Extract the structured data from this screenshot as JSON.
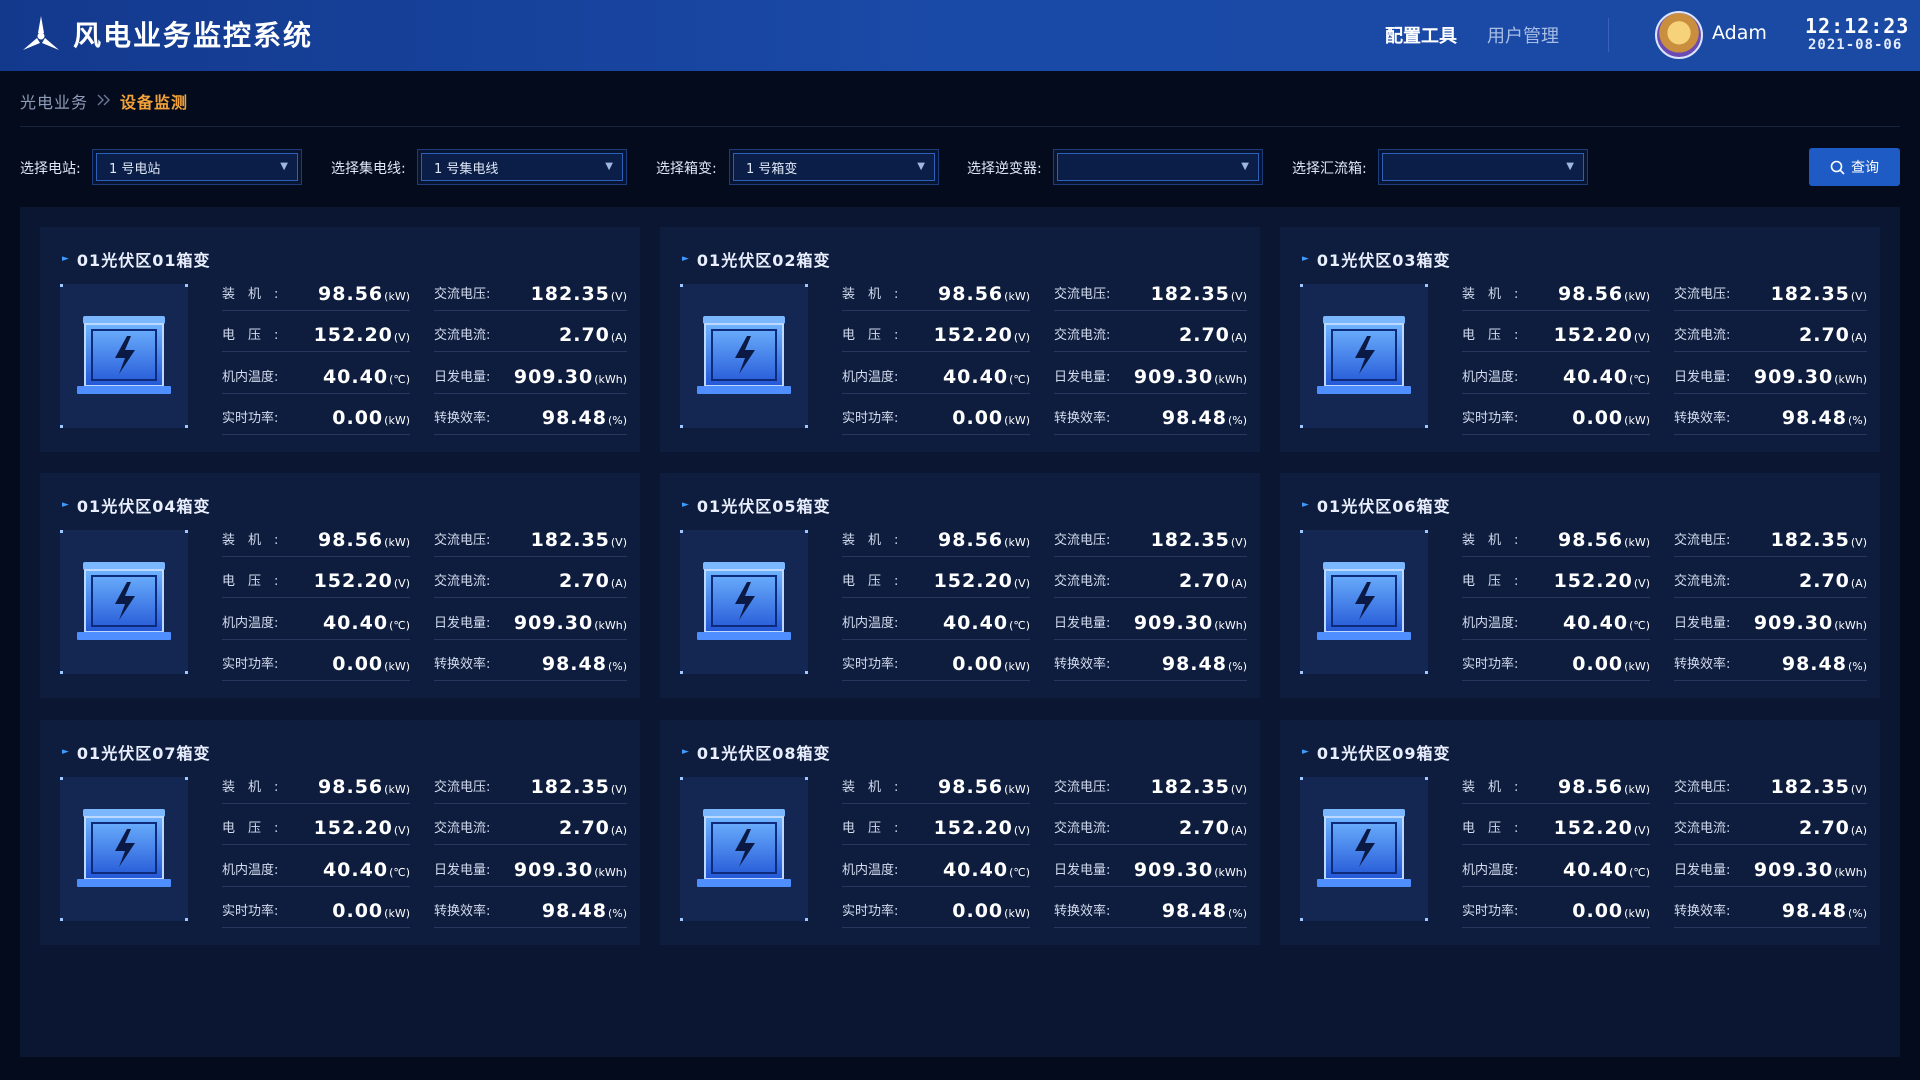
{
  "header": {
    "title": "风电业务监控系统",
    "nav": [
      "配置工具",
      "用户管理"
    ],
    "username": "Adam",
    "time": "12:12:23",
    "date": "2021-08-06"
  },
  "breadcrumb": {
    "parent": "光电业务",
    "current": "设备监测"
  },
  "filters": [
    {
      "label": "选择电站:",
      "value": "1 号电站"
    },
    {
      "label": "选择集电线:",
      "value": "1 号集电线"
    },
    {
      "label": "选择箱变:",
      "value": "1 号箱变"
    },
    {
      "label": "选择逆变器:",
      "value": ""
    },
    {
      "label": "选择汇流箱:",
      "value": ""
    }
  ],
  "query_label": "查询",
  "cards": [
    {
      "title": "01光伏区01箱变",
      "metrics": [
        {
          "label": "装　机　:",
          "value": "98.56",
          "unit": "(kW)"
        },
        {
          "label": "交流电压:",
          "value": "182.35",
          "unit": "(V)"
        },
        {
          "label": "电　压　:",
          "value": "152.20",
          "unit": "(V)"
        },
        {
          "label": "交流电流:",
          "value": "2.70",
          "unit": "(A)"
        },
        {
          "label": "机内温度:",
          "value": "40.40",
          "unit": "(℃)"
        },
        {
          "label": "日发电量:",
          "value": "909.30",
          "unit": "(kWh)"
        },
        {
          "label": "实时功率:",
          "value": "0.00",
          "unit": "(kW)"
        },
        {
          "label": "转换效率:",
          "value": "98.48",
          "unit": "(%)"
        }
      ]
    },
    {
      "title": "01光伏区02箱变",
      "metrics": [
        {
          "label": "装　机　:",
          "value": "98.56",
          "unit": "(kW)"
        },
        {
          "label": "交流电压:",
          "value": "182.35",
          "unit": "(V)"
        },
        {
          "label": "电　压　:",
          "value": "152.20",
          "unit": "(V)"
        },
        {
          "label": "交流电流:",
          "value": "2.70",
          "unit": "(A)"
        },
        {
          "label": "机内温度:",
          "value": "40.40",
          "unit": "(℃)"
        },
        {
          "label": "日发电量:",
          "value": "909.30",
          "unit": "(kWh)"
        },
        {
          "label": "实时功率:",
          "value": "0.00",
          "unit": "(kW)"
        },
        {
          "label": "转换效率:",
          "value": "98.48",
          "unit": "(%)"
        }
      ]
    },
    {
      "title": "01光伏区03箱变",
      "metrics": [
        {
          "label": "装　机　:",
          "value": "98.56",
          "unit": "(kW)"
        },
        {
          "label": "交流电压:",
          "value": "182.35",
          "unit": "(V)"
        },
        {
          "label": "电　压　:",
          "value": "152.20",
          "unit": "(V)"
        },
        {
          "label": "交流电流:",
          "value": "2.70",
          "unit": "(A)"
        },
        {
          "label": "机内温度:",
          "value": "40.40",
          "unit": "(℃)"
        },
        {
          "label": "日发电量:",
          "value": "909.30",
          "unit": "(kWh)"
        },
        {
          "label": "实时功率:",
          "value": "0.00",
          "unit": "(kW)"
        },
        {
          "label": "转换效率:",
          "value": "98.48",
          "unit": "(%)"
        }
      ]
    },
    {
      "title": "01光伏区04箱变",
      "metrics": [
        {
          "label": "装　机　:",
          "value": "98.56",
          "unit": "(kW)"
        },
        {
          "label": "交流电压:",
          "value": "182.35",
          "unit": "(V)"
        },
        {
          "label": "电　压　:",
          "value": "152.20",
          "unit": "(V)"
        },
        {
          "label": "交流电流:",
          "value": "2.70",
          "unit": "(A)"
        },
        {
          "label": "机内温度:",
          "value": "40.40",
          "unit": "(℃)"
        },
        {
          "label": "日发电量:",
          "value": "909.30",
          "unit": "(kWh)"
        },
        {
          "label": "实时功率:",
          "value": "0.00",
          "unit": "(kW)"
        },
        {
          "label": "转换效率:",
          "value": "98.48",
          "unit": "(%)"
        }
      ]
    },
    {
      "title": "01光伏区05箱变",
      "metrics": [
        {
          "label": "装　机　:",
          "value": "98.56",
          "unit": "(kW)"
        },
        {
          "label": "交流电压:",
          "value": "182.35",
          "unit": "(V)"
        },
        {
          "label": "电　压　:",
          "value": "152.20",
          "unit": "(V)"
        },
        {
          "label": "交流电流:",
          "value": "2.70",
          "unit": "(A)"
        },
        {
          "label": "机内温度:",
          "value": "40.40",
          "unit": "(℃)"
        },
        {
          "label": "日发电量:",
          "value": "909.30",
          "unit": "(kWh)"
        },
        {
          "label": "实时功率:",
          "value": "0.00",
          "unit": "(kW)"
        },
        {
          "label": "转换效率:",
          "value": "98.48",
          "unit": "(%)"
        }
      ]
    },
    {
      "title": "01光伏区06箱变",
      "metrics": [
        {
          "label": "装　机　:",
          "value": "98.56",
          "unit": "(kW)"
        },
        {
          "label": "交流电压:",
          "value": "182.35",
          "unit": "(V)"
        },
        {
          "label": "电　压　:",
          "value": "152.20",
          "unit": "(V)"
        },
        {
          "label": "交流电流:",
          "value": "2.70",
          "unit": "(A)"
        },
        {
          "label": "机内温度:",
          "value": "40.40",
          "unit": "(℃)"
        },
        {
          "label": "日发电量:",
          "value": "909.30",
          "unit": "(kWh)"
        },
        {
          "label": "实时功率:",
          "value": "0.00",
          "unit": "(kW)"
        },
        {
          "label": "转换效率:",
          "value": "98.48",
          "unit": "(%)"
        }
      ]
    },
    {
      "title": "01光伏区07箱变",
      "metrics": [
        {
          "label": "装　机　:",
          "value": "98.56",
          "unit": "(kW)"
        },
        {
          "label": "交流电压:",
          "value": "182.35",
          "unit": "(V)"
        },
        {
          "label": "电　压　:",
          "value": "152.20",
          "unit": "(V)"
        },
        {
          "label": "交流电流:",
          "value": "2.70",
          "unit": "(A)"
        },
        {
          "label": "机内温度:",
          "value": "40.40",
          "unit": "(℃)"
        },
        {
          "label": "日发电量:",
          "value": "909.30",
          "unit": "(kWh)"
        },
        {
          "label": "实时功率:",
          "value": "0.00",
          "unit": "(kW)"
        },
        {
          "label": "转换效率:",
          "value": "98.48",
          "unit": "(%)"
        }
      ]
    },
    {
      "title": "01光伏区08箱变",
      "metrics": [
        {
          "label": "装　机　:",
          "value": "98.56",
          "unit": "(kW)"
        },
        {
          "label": "交流电压:",
          "value": "182.35",
          "unit": "(V)"
        },
        {
          "label": "电　压　:",
          "value": "152.20",
          "unit": "(V)"
        },
        {
          "label": "交流电流:",
          "value": "2.70",
          "unit": "(A)"
        },
        {
          "label": "机内温度:",
          "value": "40.40",
          "unit": "(℃)"
        },
        {
          "label": "日发电量:",
          "value": "909.30",
          "unit": "(kWh)"
        },
        {
          "label": "实时功率:",
          "value": "0.00",
          "unit": "(kW)"
        },
        {
          "label": "转换效率:",
          "value": "98.48",
          "unit": "(%)"
        }
      ]
    },
    {
      "title": "01光伏区09箱变",
      "metrics": [
        {
          "label": "装　机　:",
          "value": "98.56",
          "unit": "(kW)"
        },
        {
          "label": "交流电压:",
          "value": "182.35",
          "unit": "(V)"
        },
        {
          "label": "电　压　:",
          "value": "152.20",
          "unit": "(V)"
        },
        {
          "label": "交流电流:",
          "value": "2.70",
          "unit": "(A)"
        },
        {
          "label": "机内温度:",
          "value": "40.40",
          "unit": "(℃)"
        },
        {
          "label": "日发电量:",
          "value": "909.30",
          "unit": "(kWh)"
        },
        {
          "label": "实时功率:",
          "value": "0.00",
          "unit": "(kW)"
        },
        {
          "label": "转换效率:",
          "value": "98.48",
          "unit": "(%)"
        }
      ]
    }
  ],
  "colors": {
    "header_bg": "#1a4aa8",
    "accent_orange": "#f2a23a",
    "accent_blue": "#1e5bc4",
    "panel_bg": "#0b1732",
    "card_bg": "#0e1d3d"
  },
  "icons": {
    "logo": "wind-turbine-icon",
    "device": "box-transformer-lightning-icon",
    "search": "search-icon",
    "caret": "caret-down-icon",
    "breadcrumb_sep": "chevron-double-right-icon"
  }
}
